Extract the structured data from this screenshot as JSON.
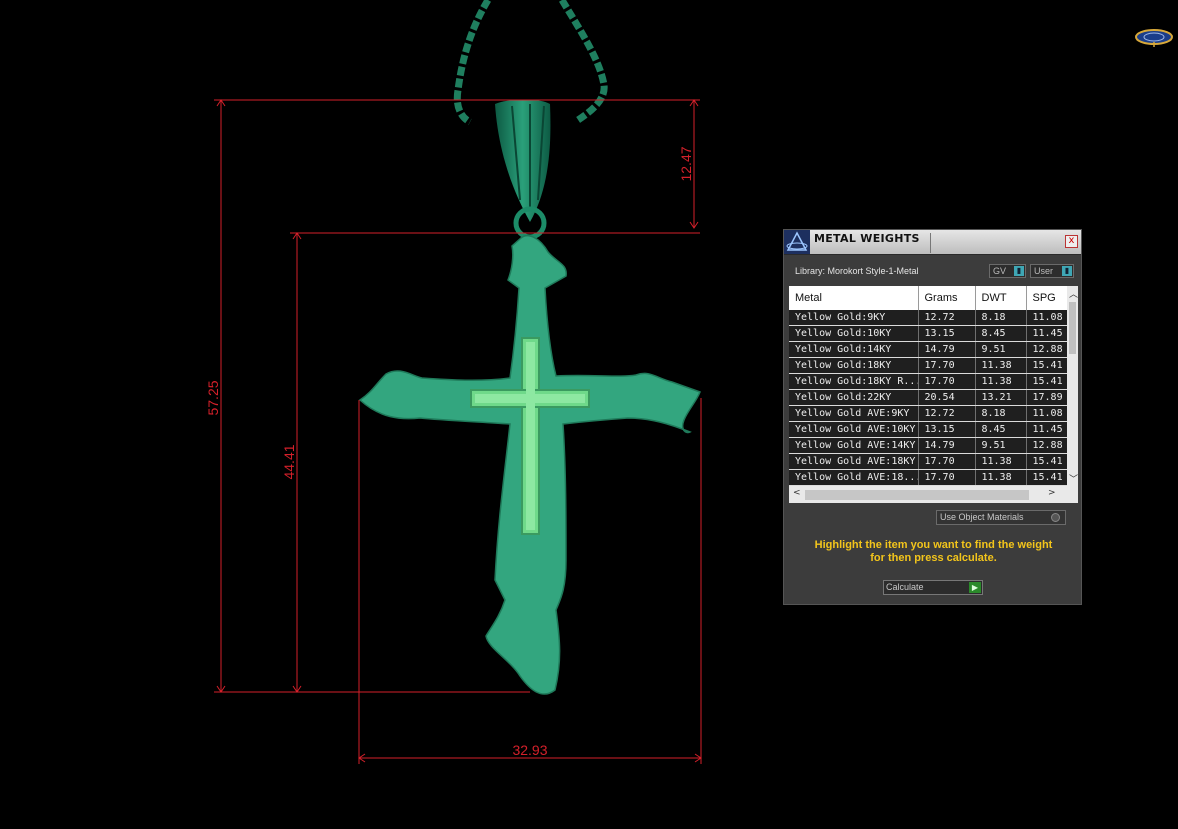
{
  "dimensions": {
    "overall_height": "57.25",
    "bail_height": "12.47",
    "cross_height": "44.41",
    "cross_width": "32.93"
  },
  "colors": {
    "dimension_lines": "#d4202a",
    "cross": "#33a67f",
    "inlay": "#6fd98a",
    "chain": "#1f7f5f",
    "accent_text": "#f3c51b"
  },
  "panel": {
    "title": "METAL WEIGHTS",
    "close_icon": "x",
    "library_label": "Library: Morokort Style-1-Metal",
    "toggles": {
      "gv": "GV",
      "user": "User"
    },
    "table": {
      "headers": [
        "Metal",
        "Grams",
        "DWT",
        "SPG"
      ],
      "rows": [
        [
          "Yellow Gold:9KY",
          "12.72",
          "8.18",
          "11.08"
        ],
        [
          "Yellow Gold:10KY",
          "13.15",
          "8.45",
          "11.45"
        ],
        [
          "Yellow Gold:14KY",
          "14.79",
          "9.51",
          "12.88"
        ],
        [
          "Yellow Gold:18KY",
          "17.70",
          "11.38",
          "15.41"
        ],
        [
          "Yellow Gold:18KY R...",
          "17.70",
          "11.38",
          "15.41"
        ],
        [
          "Yellow Gold:22KY",
          "20.54",
          "13.21",
          "17.89"
        ],
        [
          "Yellow Gold AVE:9KY",
          "12.72",
          "8.18",
          "11.08"
        ],
        [
          "Yellow Gold AVE:10KY",
          "13.15",
          "8.45",
          "11.45"
        ],
        [
          "Yellow Gold AVE:14KY",
          "14.79",
          "9.51",
          "12.88"
        ],
        [
          "Yellow Gold AVE:18KY",
          "17.70",
          "11.38",
          "15.41"
        ],
        [
          "Yellow Gold AVE:18...",
          "17.70",
          "11.38",
          "15.41"
        ]
      ]
    },
    "use_object_materials": "Use Object Materials",
    "instructions": [
      "Highlight the item you want to find the weight",
      "for then press calculate."
    ],
    "calculate_label": "Calculate"
  }
}
